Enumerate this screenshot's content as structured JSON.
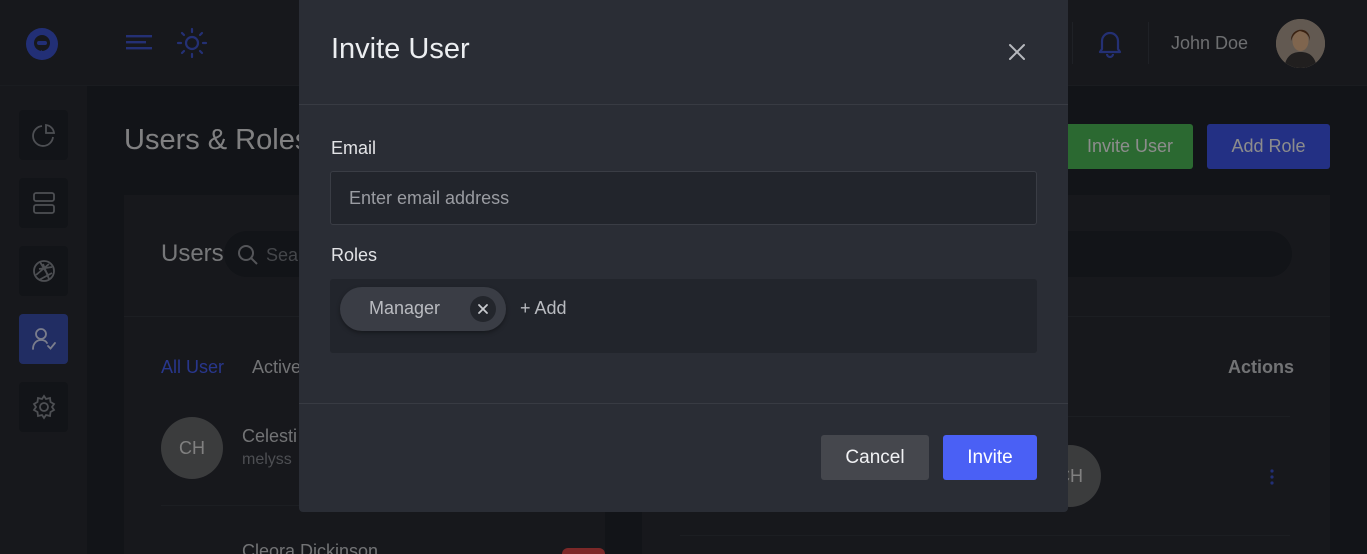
{
  "header": {
    "user_name": "John Doe",
    "accent_color": "#4a60f5"
  },
  "sidebar": {
    "items": [
      {
        "icon": "pie-chart-icon",
        "active": false
      },
      {
        "icon": "server-icon",
        "active": false
      },
      {
        "icon": "aperture-icon",
        "active": false
      },
      {
        "icon": "user-check-icon",
        "active": true
      },
      {
        "icon": "gear-icon",
        "active": false
      }
    ]
  },
  "page": {
    "title": "Users & Roles",
    "invite_user_label": "Invite User",
    "add_role_label": "Add Role"
  },
  "users_panel": {
    "title": "Users",
    "search_placeholder": "Sea",
    "tabs": [
      "All User",
      "Active"
    ],
    "actions_header": "Actions",
    "rows": [
      {
        "initials": "CH",
        "name": "Celesti",
        "email": "melyss"
      },
      {
        "name": "Cleora Dickinson"
      }
    ],
    "detail_initials": "CH"
  },
  "modal": {
    "title": "Invite User",
    "email_label": "Email",
    "email_placeholder": "Enter email address",
    "roles_label": "Roles",
    "roles": [
      "Manager"
    ],
    "add_label": "+ Add",
    "cancel_label": "Cancel",
    "invite_label": "Invite"
  }
}
